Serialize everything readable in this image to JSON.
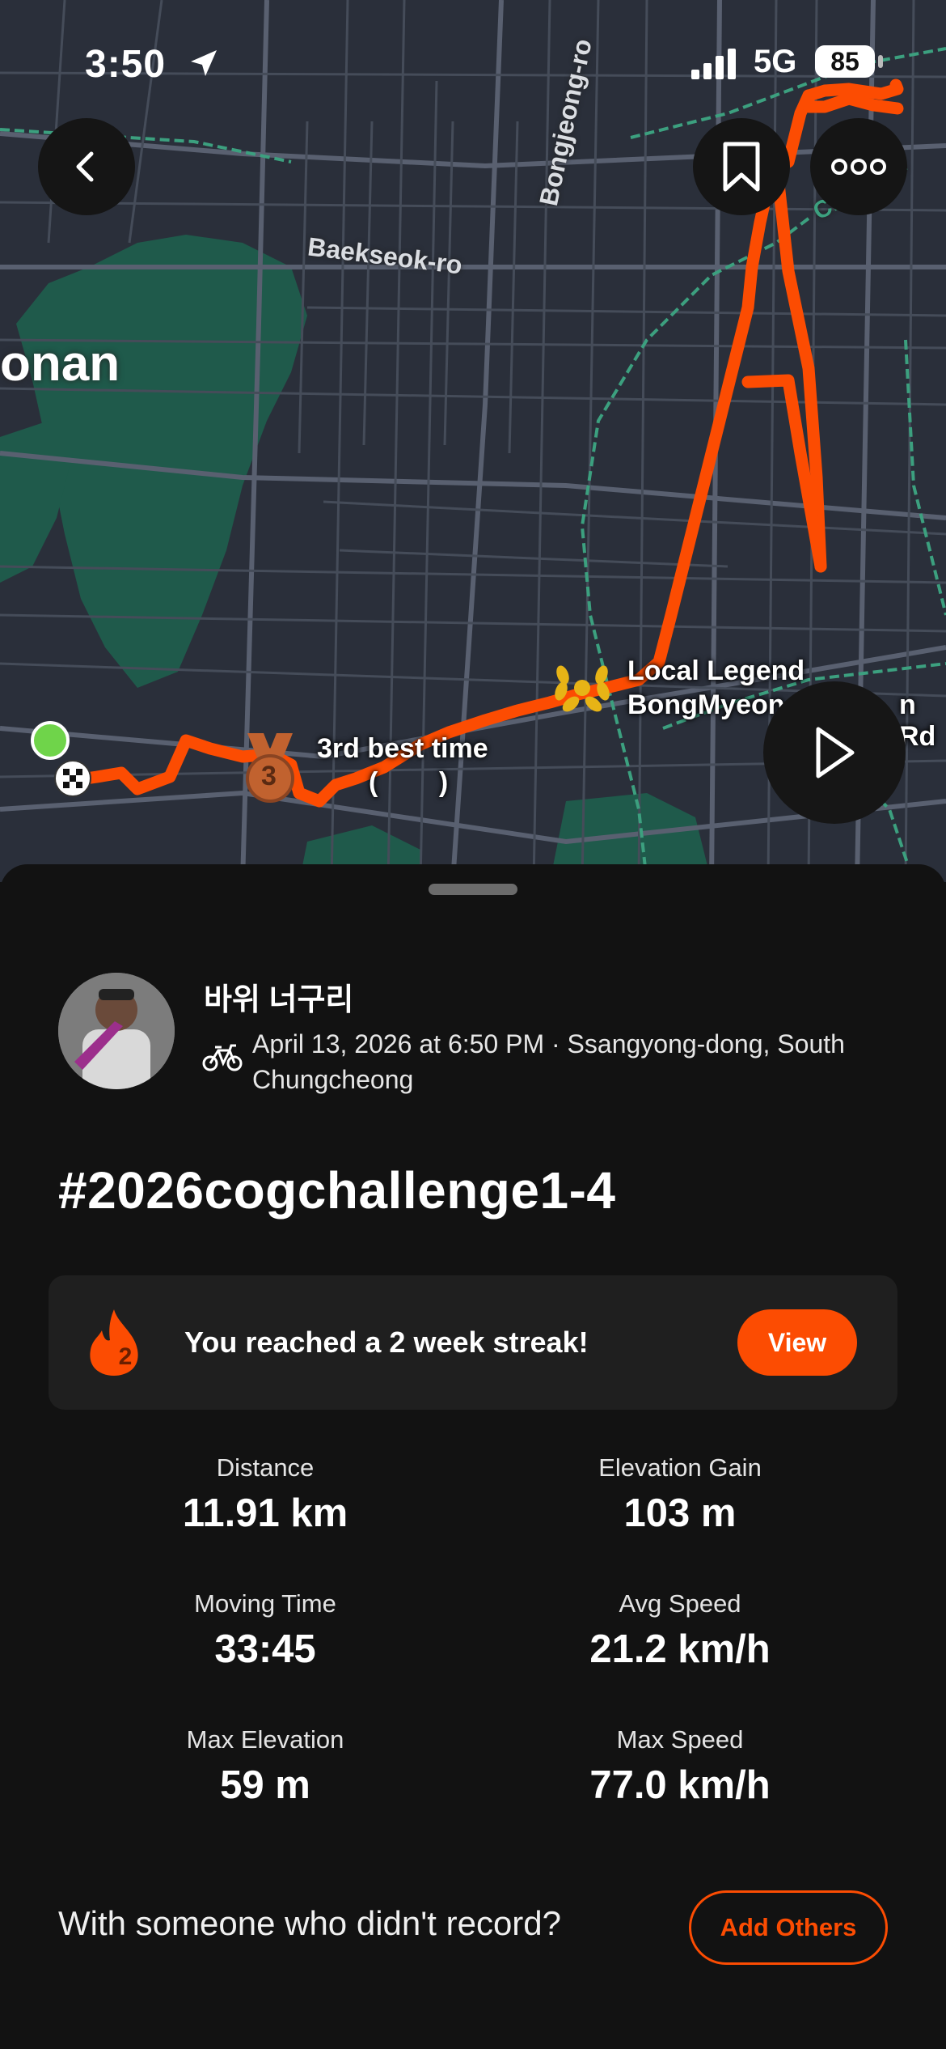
{
  "status_bar": {
    "time": "3:50",
    "network": "5G",
    "battery": "85"
  },
  "map": {
    "streets": [
      "Baekseok-ro",
      "Bongjeong-ro",
      "Cheonan"
    ],
    "area_label": "onan",
    "local_legend": {
      "line1": "Local Legend",
      "line2": "BongMyeon",
      "line3": "n Rd"
    },
    "achievement": {
      "label": "3rd best time",
      "sublabel": "(        )",
      "medal_rank": "3"
    },
    "route_color": "#fc4c02"
  },
  "activity": {
    "athlete_name": "바위 너구리",
    "meta": "April 13, 2026 at 6:50 PM · Ssangyong-dong, South Chungcheong",
    "title": "#2026cogchallenge1-4"
  },
  "streak": {
    "count": "2",
    "text": "You reached a 2 week streak!",
    "button": "View"
  },
  "stats": [
    {
      "label": "Distance",
      "value": "11.91 km"
    },
    {
      "label": "Elevation Gain",
      "value": "103 m"
    },
    {
      "label": "Moving Time",
      "value": "33:45"
    },
    {
      "label": "Avg Speed",
      "value": "21.2 km/h"
    },
    {
      "label": "Max Elevation",
      "value": "59 m"
    },
    {
      "label": "Max Speed",
      "value": "77.0 km/h"
    }
  ],
  "footer": {
    "prompt": "With someone who didn't record?",
    "button": "Add Others"
  },
  "colors": {
    "accent": "#fc4c02",
    "background": "#121212",
    "map_bg": "#2a2f3a",
    "park": "#1f5a4b"
  },
  "icons": [
    "location-arrow-icon",
    "signal-icon",
    "back-icon",
    "bookmark-icon",
    "more-icon",
    "play-icon",
    "medal-icon",
    "laurel-icon",
    "bike-icon",
    "flame-icon"
  ]
}
